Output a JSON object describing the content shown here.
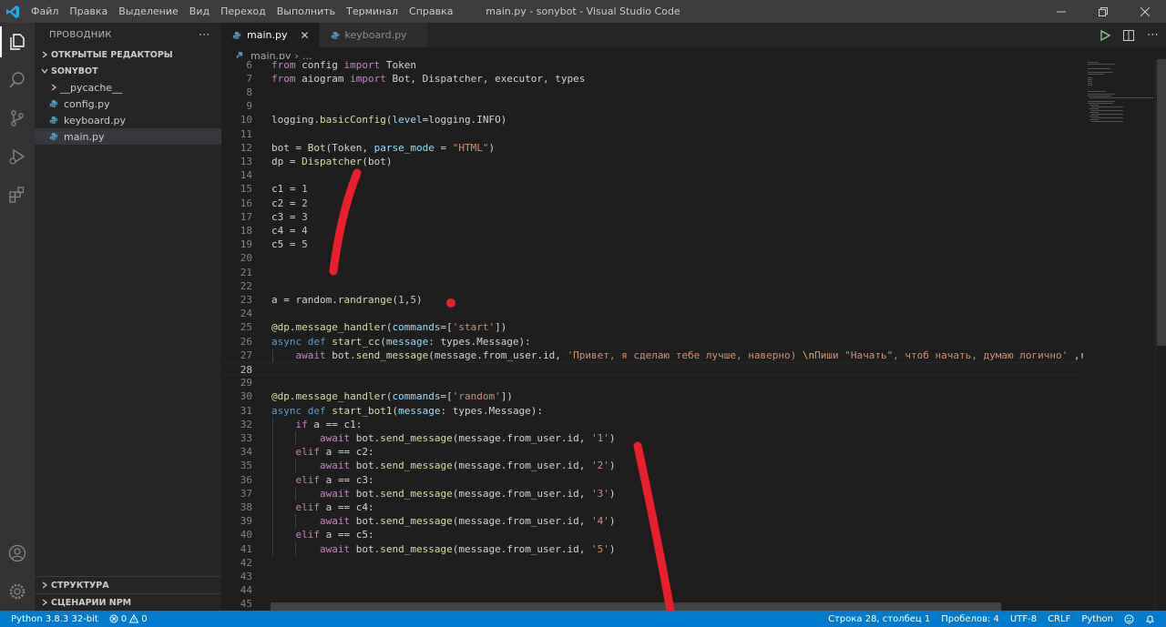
{
  "titlebar": {
    "menu": [
      "Файл",
      "Правка",
      "Выделение",
      "Вид",
      "Переход",
      "Выполнить",
      "Терминал",
      "Справка"
    ],
    "title": "main.py - sonybot - Visual Studio Code"
  },
  "sidebar": {
    "header": "ПРОВОДНИК",
    "open_editors": "ОТКРЫТЫЕ РЕДАКТОРЫ",
    "project": "SONYBOT",
    "items": [
      "__pycache__",
      "config.py",
      "keyboard.py",
      "main.py"
    ],
    "structure": "СТРУКТУРА",
    "npm_scripts": "СЦЕНАРИИ NPM"
  },
  "tabs": [
    {
      "label": "main.py"
    },
    {
      "label": "keyboard.py"
    }
  ],
  "breadcrumb": {
    "file": "main.py",
    "rest": "..."
  },
  "editor": {
    "lines": [
      {
        "n": "6",
        "html": "<span class='kw'>from</span> config <span class='kw'>import</span> Token"
      },
      {
        "n": "7",
        "html": "<span class='kw'>from</span> aiogram <span class='kw'>import</span> Bot, Dispatcher, executor, types"
      },
      {
        "n": "8",
        "html": ""
      },
      {
        "n": "9",
        "html": ""
      },
      {
        "n": "10",
        "html": "logging.<span class='fn'>basicConfig</span>(<span class='par'>level</span>=logging.INFO)"
      },
      {
        "n": "11",
        "html": ""
      },
      {
        "n": "12",
        "html": "bot = <span class='fn'>Bot</span>(Token, <span class='par'>parse_mode</span> = <span class='str'>\"HTML\"</span>)"
      },
      {
        "n": "13",
        "html": "dp = <span class='fn'>Dispatcher</span>(bot)"
      },
      {
        "n": "14",
        "html": ""
      },
      {
        "n": "15",
        "html": "c1 = <span class='num'>1</span>"
      },
      {
        "n": "16",
        "html": "c2 = <span class='num'>2</span>"
      },
      {
        "n": "17",
        "html": "c3 = <span class='num'>3</span>"
      },
      {
        "n": "18",
        "html": "c4 = <span class='num'>4</span>"
      },
      {
        "n": "19",
        "html": "c5 = <span class='num'>5</span>"
      },
      {
        "n": "20",
        "html": ""
      },
      {
        "n": "21",
        "html": ""
      },
      {
        "n": "22",
        "html": ""
      },
      {
        "n": "23",
        "html": "a = random.<span class='fn'>randrange</span>(<span class='num'>1</span>,<span class='num'>5</span>)"
      },
      {
        "n": "24",
        "html": ""
      },
      {
        "n": "25",
        "html": "<span class='fn'>@dp.message_handler</span>(<span class='par'>commands</span>=[<span class='str'>'start'</span>])"
      },
      {
        "n": "26",
        "html": "<span class='kw2'>async</span> <span class='kw2'>def</span> <span class='fn'>start_cc</span>(<span class='par'>message</span>: types.Message):"
      },
      {
        "n": "27",
        "html": "    <span class='kw'>await</span> bot.<span class='fn'>send_message</span>(message.from_user.id, <span class='str'>'Привет, я сделаю тебе лучше, наверно) </span><span class='esc'>\\n</span><span class='str'>Пиши \"Начать\", чтоб начать, думаю логично'</span> ,<span class='par'>reply_markup</span>"
      },
      {
        "n": "28",
        "html": ""
      },
      {
        "n": "29",
        "html": ""
      },
      {
        "n": "30",
        "html": "<span class='fn'>@dp.message_handler</span>(<span class='par'>commands</span>=[<span class='str'>'random'</span>])"
      },
      {
        "n": "31",
        "html": "<span class='kw2'>async</span> <span class='kw2'>def</span> <span class='fn'>start_bot1</span>(<span class='par'>message</span>: types.Message):"
      },
      {
        "n": "32",
        "html": "    <span class='kw'>if</span> a == c1:"
      },
      {
        "n": "33",
        "html": "        <span class='kw'>await</span> bot.<span class='fn'>send_message</span>(message.from_user.id, <span class='str'>'1'</span>)"
      },
      {
        "n": "34",
        "html": "    <span class='kw'>elif</span> a == c2:"
      },
      {
        "n": "35",
        "html": "        <span class='kw'>await</span> bot.<span class='fn'>send_message</span>(message.from_user.id, <span class='str'>'2'</span>)"
      },
      {
        "n": "36",
        "html": "    <span class='kw'>elif</span> a == c3:"
      },
      {
        "n": "37",
        "html": "        <span class='kw'>await</span> bot.<span class='fn'>send_message</span>(message.from_user.id, <span class='str'>'3'</span>)"
      },
      {
        "n": "38",
        "html": "    <span class='kw'>elif</span> a == c4:"
      },
      {
        "n": "39",
        "html": "        <span class='kw'>await</span> bot.<span class='fn'>send_message</span>(message.from_user.id, <span class='str'>'4'</span>)"
      },
      {
        "n": "40",
        "html": "    <span class='kw'>elif</span> a == c5:"
      },
      {
        "n": "41",
        "html": "        <span class='kw'>await</span> bot.<span class='fn'>send_message</span>(message.from_user.id, <span class='str'>'5'</span>)"
      },
      {
        "n": "42",
        "html": ""
      },
      {
        "n": "43",
        "html": ""
      },
      {
        "n": "44",
        "html": ""
      },
      {
        "n": "45",
        "html": ""
      }
    ],
    "current_line": "28"
  },
  "statusbar": {
    "python": "Python 3.8.3 32-bit",
    "errors": "0",
    "warnings": "0",
    "position": "Строка 28, столбец 1",
    "spaces": "Пробелов: 4",
    "encoding": "UTF-8",
    "eol": "CRLF",
    "language": "Python"
  },
  "colors": {
    "accent": "#007acc",
    "titlebar": "#3c3c3c",
    "editor_bg": "#1e1e1e",
    "annotation": "#e8202a"
  }
}
